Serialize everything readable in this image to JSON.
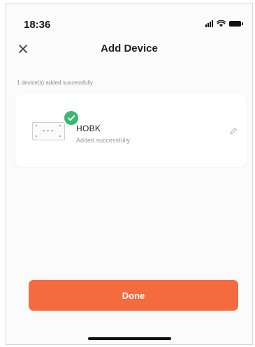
{
  "status_bar": {
    "time": "18:36",
    "icons": [
      "signal-icon",
      "wifi-icon",
      "battery-icon"
    ]
  },
  "header": {
    "close_icon": "close-icon",
    "title": "Add Device"
  },
  "summary": {
    "text": "1 device(s) added successfully"
  },
  "devices": [
    {
      "name": "HOBK",
      "status": "Added successfully",
      "status_icon": "success-check-icon",
      "edit_icon": "edit-icon"
    }
  ],
  "actions": {
    "done_label": "Done"
  },
  "colors": {
    "accent": "#f46b3f",
    "success": "#3ab86f",
    "muted_text": "#8a8a8a",
    "background": "#fbfbfb"
  }
}
